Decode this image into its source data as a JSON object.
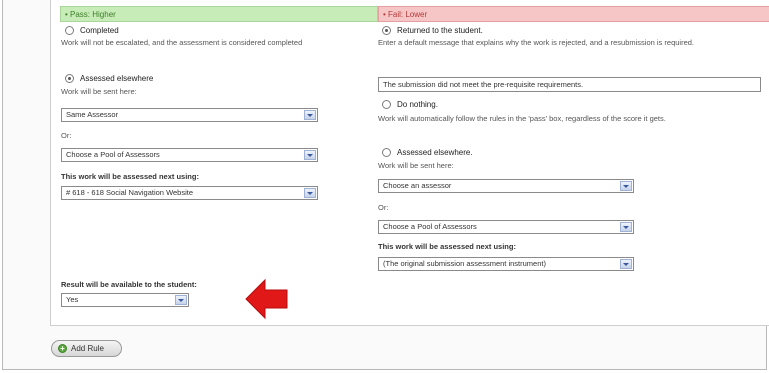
{
  "pass": {
    "header": "• Pass: Higher",
    "completed": {
      "label": "Completed",
      "description": "Work will not be escalated, and the assessment is considered completed"
    },
    "assessed_elsewhere": {
      "label": "Assessed elsewhere",
      "sent_here": "Work will be sent here:",
      "assessor_select": "Same Assessor",
      "or_label": "Or:",
      "pool_select": "Choose a Pool of Assessors",
      "next_using_label": "This work will be assessed next using:",
      "instrument_select": "# 618 - 618 Social Navigation Website"
    },
    "result_label": "Result will be available to the student:",
    "result_select": "Yes"
  },
  "fail": {
    "header": "• Fail: Lower",
    "returned": {
      "label": "Returned to the student.",
      "description": "Enter a default message that explains why the work is rejected, and a resubmission is required.",
      "message_value": "The submission did not meet the pre-requisite requirements."
    },
    "do_nothing": {
      "label": "Do nothing.",
      "description": "Work will automatically follow the rules in the 'pass' box, regardless of the score it gets."
    },
    "assessed_elsewhere": {
      "label": "Assessed elsewhere.",
      "sent_here": "Work will be sent here:",
      "assessor_select": "Choose an assessor",
      "or_label": "Or:",
      "pool_select": "Choose a Pool of Assessors",
      "next_using_label": "This work will be assessed next using:",
      "instrument_select": "(The original submission assessment instrument)"
    }
  },
  "add_rule_label": "Add Rule",
  "colors": {
    "pass_bg": "#c8ecb8",
    "fail_bg": "#f6c5c5",
    "arrow": "#e01818"
  }
}
